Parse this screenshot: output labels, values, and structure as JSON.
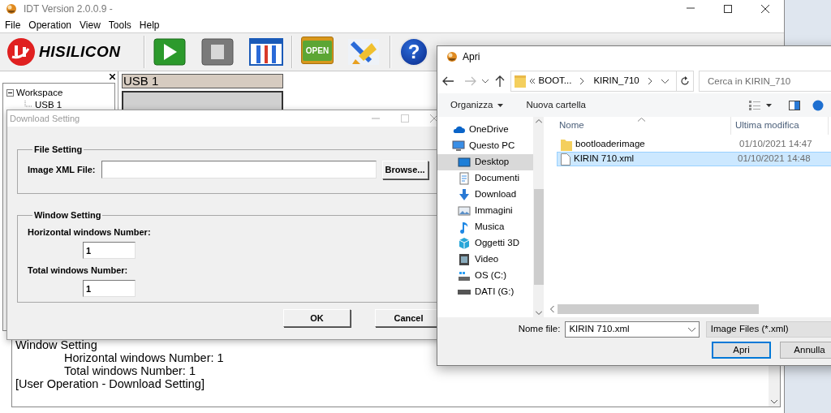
{
  "main_window": {
    "title": "IDT Version 2.0.0.9 -",
    "menu": [
      "File",
      "Operation",
      "View",
      "Tools",
      "Help"
    ],
    "toolbar": {
      "logo": "HISILICON",
      "groups": [
        [
          {
            "kind": "play"
          },
          {
            "kind": "stop"
          },
          {
            "kind": "settings"
          }
        ],
        [
          {
            "kind": "open",
            "label": "OPEN"
          },
          {
            "kind": "clean"
          }
        ],
        [
          {
            "kind": "help",
            "label": "?"
          }
        ]
      ]
    },
    "workspace_tree": [
      {
        "label": "Workspace",
        "expanded": true,
        "children": [
          {
            "label": "USB 1"
          }
        ]
      }
    ],
    "port_tab": "USB 1",
    "log": [
      {
        "text": "Window Setting",
        "children": [
          {
            "text": "Horizontal windows Number: 1"
          },
          {
            "text": "Total windows Number: 1"
          }
        ]
      },
      {
        "text": "[User Operation - Download Setting]"
      }
    ]
  },
  "download_dialog": {
    "title": "Download Setting",
    "file_setting": {
      "legend": "File Setting",
      "label": "Image XML File:",
      "button": "Browse..."
    },
    "window_setting": {
      "legend": "Window Setting",
      "fields": [
        {
          "label": "Horizontal windows Number:",
          "value": "1"
        },
        {
          "label": "Total windows Number:",
          "value": "1"
        }
      ]
    },
    "buttons": [
      "OK",
      "Cancel"
    ]
  },
  "open_dialog": {
    "title": "Apri",
    "history": {
      "back_enabled": true,
      "forward_enabled": false
    },
    "breadcrumb": [
      "BOOT...",
      "KIRIN_710"
    ],
    "search_placeholder": "Cerca in KIRIN_710",
    "toolbar": [
      {
        "label": "Organizza",
        "dropdown": true
      },
      {
        "label": "Nuova cartella",
        "dropdown": false
      }
    ],
    "nav": [
      {
        "label": "OneDrive",
        "kind": "cloud",
        "selected": false
      },
      {
        "label": "Questo PC",
        "kind": "pc",
        "selected": false,
        "children": [
          {
            "label": "Desktop",
            "kind": "desktop",
            "selected": true
          },
          {
            "label": "Documenti",
            "kind": "documents",
            "selected": false
          },
          {
            "label": "Download",
            "kind": "download",
            "selected": false
          },
          {
            "label": "Immagini",
            "kind": "pictures",
            "selected": false
          },
          {
            "label": "Musica",
            "kind": "music",
            "selected": false
          },
          {
            "label": "Oggetti 3D",
            "kind": "objects3d",
            "selected": false
          },
          {
            "label": "Video",
            "kind": "video",
            "selected": false
          },
          {
            "label": "OS (C:)",
            "kind": "system_drive",
            "selected": false
          },
          {
            "label": "DATI (G:)",
            "kind": "drive",
            "selected": false
          }
        ]
      }
    ],
    "columns": [
      "Nome",
      "Ultima modifica"
    ],
    "files": [
      {
        "name": "bootloaderimage",
        "kind": "folder",
        "modified": "01/10/2021 14:47",
        "selected": false
      },
      {
        "name": "KIRIN 710.xml",
        "kind": "file",
        "modified": "01/10/2021 14:48",
        "selected": true
      }
    ],
    "filename_label": "Nome file:",
    "filename": "KIRIN 710.xml",
    "filter": "Image Files (*.xml)",
    "buttons": [
      {
        "label": "Apri",
        "default": true
      },
      {
        "label": "Annulla",
        "default": false
      }
    ]
  }
}
